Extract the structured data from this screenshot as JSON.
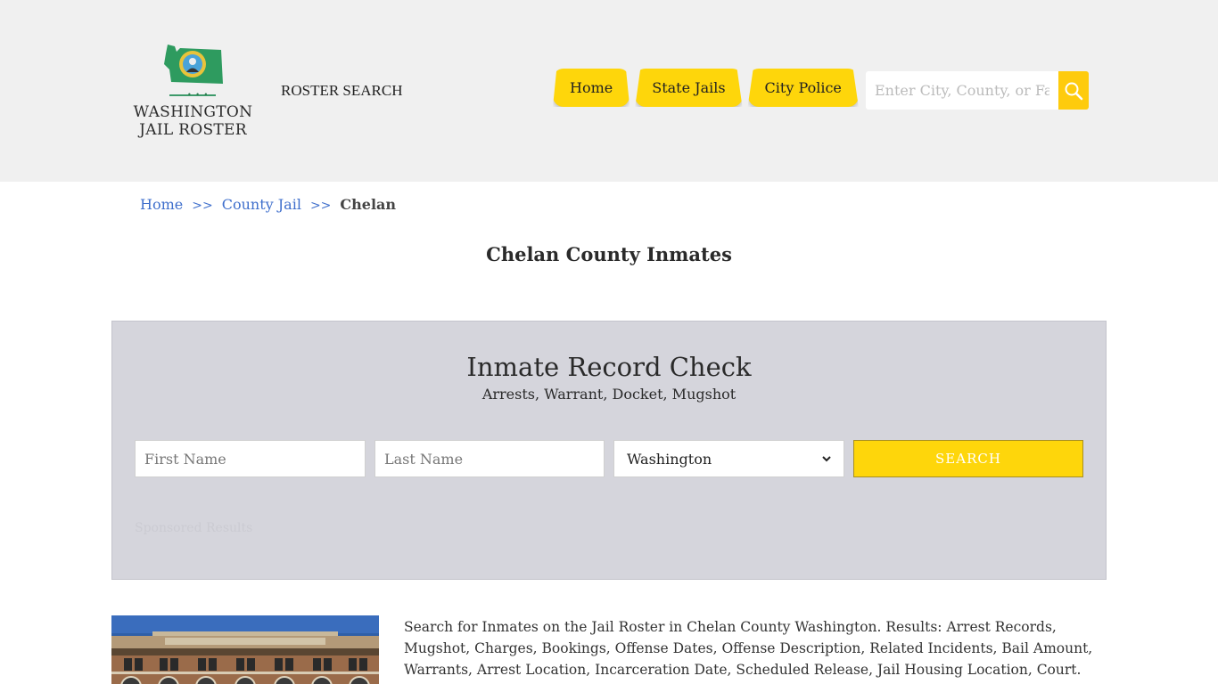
{
  "header": {
    "logo": {
      "line1": "WASHINGTON",
      "line2": "JAIL ROSTER",
      "icon": "washington-state-seal-icon",
      "dots": "• • •"
    },
    "roster_search_label": "ROSTER SEARCH",
    "nav": [
      {
        "label": "Home"
      },
      {
        "label": "State Jails"
      },
      {
        "label": "City Police"
      }
    ],
    "search": {
      "placeholder": "Enter City, County, or Facility",
      "button_icon": "search-icon"
    }
  },
  "breadcrumb": {
    "items": [
      {
        "label": "Home"
      },
      {
        "label": "County Jail"
      }
    ],
    "separator": ">>",
    "current": "Chelan"
  },
  "page_title": "Chelan County Inmates",
  "record_check": {
    "title": "Inmate Record Check",
    "subtitle": "Arrests, Warrant, Docket, Mugshot",
    "first_name_placeholder": "First Name",
    "last_name_placeholder": "Last Name",
    "state_selected": "Washington",
    "submit_label": "SEARCH",
    "sponsored_label": "Sponsored Results"
  },
  "content": {
    "image_alt": "Chelan County jail building",
    "description": "Search for Inmates on the Jail Roster in Chelan County Washington. Results: Arrest Records, Mugshot, Charges, Bookings, Offense Dates, Offense Description, Related Incidents, Bail Amount, Warrants, Arrest Location, Incarceration Date, Scheduled Release, Jail Housing Location, Court."
  },
  "colors": {
    "accent_yellow": "#fed60b",
    "header_bg": "#f0f0f0",
    "panel_bg": "#d5d5dc",
    "link_blue": "#3f6fcc",
    "logo_green": "#2e8b57"
  }
}
